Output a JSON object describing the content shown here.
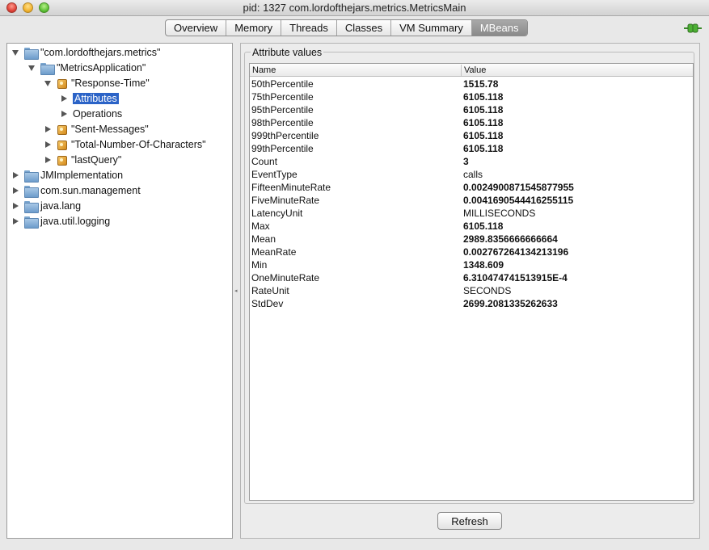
{
  "window": {
    "title": "pid: 1327 com.lordofthejars.metrics.MetricsMain"
  },
  "tabs": [
    "Overview",
    "Memory",
    "Threads",
    "Classes",
    "VM Summary",
    "MBeans"
  ],
  "active_tab": "MBeans",
  "tree": [
    {
      "label": "\"com.lordofthejars.metrics\"",
      "icon": "folder-icon",
      "arrow": "down",
      "indent": 0
    },
    {
      "label": "\"MetricsApplication\"",
      "icon": "folder-icon",
      "arrow": "down",
      "indent": 1
    },
    {
      "label": "\"Response-Time\"",
      "icon": "mbean-icon",
      "arrow": "down",
      "indent": 2
    },
    {
      "label": "Attributes",
      "icon": "",
      "arrow": "right",
      "indent": 3,
      "selected": true
    },
    {
      "label": "Operations",
      "icon": "",
      "arrow": "right",
      "indent": 3
    },
    {
      "label": "\"Sent-Messages\"",
      "icon": "mbean-icon",
      "arrow": "right",
      "indent": 2
    },
    {
      "label": "\"Total-Number-Of-Characters\"",
      "icon": "mbean-icon",
      "arrow": "right",
      "indent": 2
    },
    {
      "label": "\"lastQuery\"",
      "icon": "mbean-icon",
      "arrow": "right",
      "indent": 2
    },
    {
      "label": "JMImplementation",
      "icon": "folder-icon",
      "arrow": "right",
      "indent": 0
    },
    {
      "label": "com.sun.management",
      "icon": "folder-icon",
      "arrow": "right",
      "indent": 0
    },
    {
      "label": "java.lang",
      "icon": "folder-icon",
      "arrow": "right",
      "indent": 0
    },
    {
      "label": "java.util.logging",
      "icon": "folder-icon",
      "arrow": "right",
      "indent": 0
    }
  ],
  "attributes": {
    "title": "Attribute values",
    "columns": {
      "name": "Name",
      "value": "Value"
    },
    "rows": [
      {
        "name": "50thPercentile",
        "value": "1515.78",
        "bold": true
      },
      {
        "name": "75thPercentile",
        "value": "6105.118",
        "bold": true
      },
      {
        "name": "95thPercentile",
        "value": "6105.118",
        "bold": true
      },
      {
        "name": "98thPercentile",
        "value": "6105.118",
        "bold": true
      },
      {
        "name": "999thPercentile",
        "value": "6105.118",
        "bold": true
      },
      {
        "name": "99thPercentile",
        "value": "6105.118",
        "bold": true
      },
      {
        "name": "Count",
        "value": "3",
        "bold": true
      },
      {
        "name": "EventType",
        "value": "calls",
        "bold": false
      },
      {
        "name": "FifteenMinuteRate",
        "value": "0.0024900871545877955",
        "bold": true
      },
      {
        "name": "FiveMinuteRate",
        "value": "0.0041690544416255115",
        "bold": true
      },
      {
        "name": "LatencyUnit",
        "value": "MILLISECONDS",
        "bold": false
      },
      {
        "name": "Max",
        "value": "6105.118",
        "bold": true
      },
      {
        "name": "Mean",
        "value": "2989.8356666666664",
        "bold": true
      },
      {
        "name": "MeanRate",
        "value": "0.002767264134213196",
        "bold": true
      },
      {
        "name": "Min",
        "value": "1348.609",
        "bold": true
      },
      {
        "name": "OneMinuteRate",
        "value": "6.310474741513915E-4",
        "bold": true
      },
      {
        "name": "RateUnit",
        "value": "SECONDS",
        "bold": false
      },
      {
        "name": "StdDev",
        "value": "2699.2081335262633",
        "bold": true
      }
    ]
  },
  "refresh_label": "Refresh"
}
